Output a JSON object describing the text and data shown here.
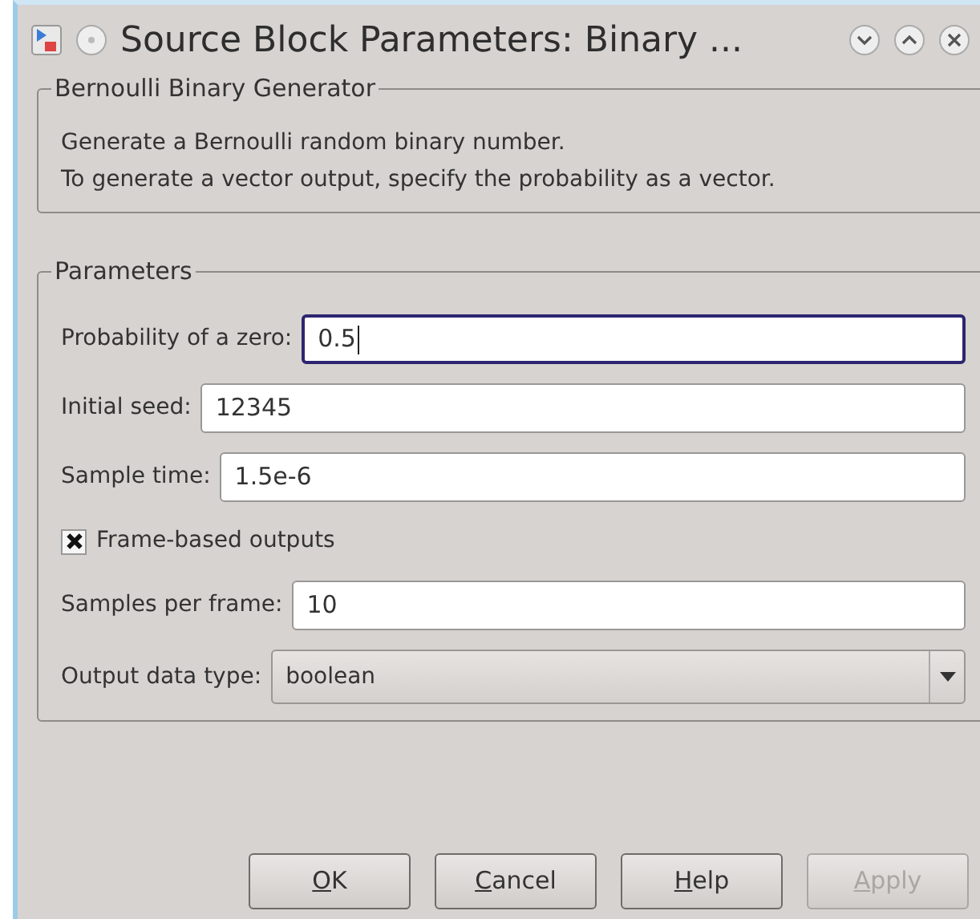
{
  "window": {
    "title": "Source Block Parameters: Binary ..."
  },
  "description": {
    "title": "Bernoulli Binary Generator",
    "lines": [
      "Generate a Bernoulli random binary number.",
      "To generate a vector output, specify the probability as a vector."
    ]
  },
  "parameters": {
    "title": "Parameters",
    "rows": [
      {
        "kind": "text",
        "label": "Probability of a zero:",
        "value": "0.5",
        "focused": true
      },
      {
        "kind": "text",
        "label": "Initial seed:",
        "value": "12345",
        "focused": false
      },
      {
        "kind": "text",
        "label": "Sample time:",
        "value": "1.5e-6",
        "focused": false
      },
      {
        "kind": "checkbox",
        "label": "Frame-based outputs",
        "checked": true
      },
      {
        "kind": "text",
        "label": "Samples per frame:",
        "value": "10",
        "focused": false
      },
      {
        "kind": "select",
        "label": "Output data type:",
        "value": "boolean"
      }
    ]
  },
  "buttons": [
    {
      "label": "OK",
      "mnemonic": true,
      "disabled": false
    },
    {
      "label": "Cancel",
      "mnemonic": true,
      "disabled": false
    },
    {
      "label": "Help",
      "mnemonic": true,
      "disabled": false
    },
    {
      "label": "Apply",
      "mnemonic": true,
      "disabled": true
    }
  ]
}
